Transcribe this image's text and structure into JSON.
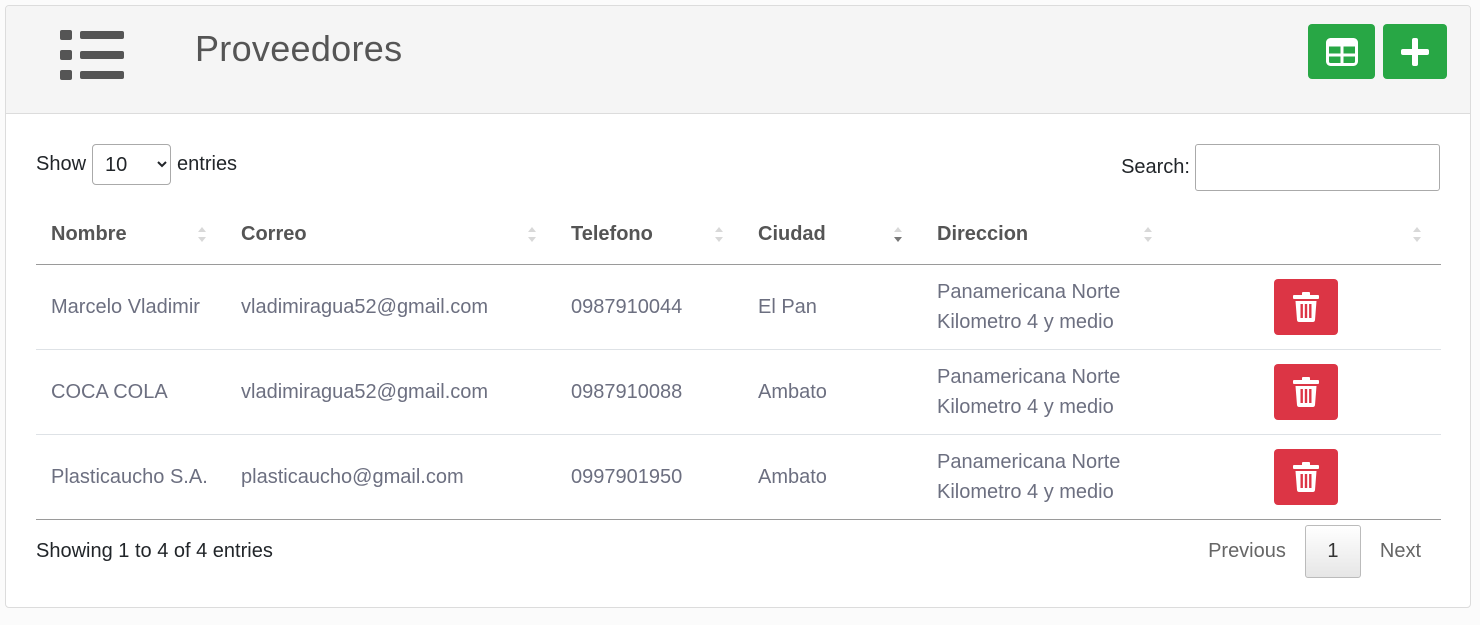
{
  "header": {
    "title": "Proveedores",
    "menu_icon": "list-icon",
    "buttons": [
      {
        "icon": "table-icon",
        "color": "#28a745"
      },
      {
        "icon": "plus-icon",
        "color": "#28a745"
      }
    ]
  },
  "length": {
    "prefix": "Show",
    "value": "10",
    "suffix": "entries"
  },
  "search": {
    "label": "Search:",
    "value": "",
    "placeholder": ""
  },
  "table": {
    "columns": [
      "Nombre",
      "Correo",
      "Telefono",
      "Ciudad",
      "Direccion",
      ""
    ],
    "rows": [
      {
        "nombre": "Marcelo Vladimir",
        "correo": "vladimiragua52@gmail.com",
        "telefono": "0987910044",
        "ciudad": "El Pan",
        "direccion": "Panamericana Norte Kilometro 4 y medio"
      },
      {
        "nombre": "COCA COLA",
        "correo": "vladimiragua52@gmail.com",
        "telefono": "0987910088",
        "ciudad": "Ambato",
        "direccion": "Panamericana Norte Kilometro 4 y medio"
      },
      {
        "nombre": "Plasticaucho S.A.",
        "correo": "plasticaucho@gmail.com",
        "telefono": "0997901950",
        "ciudad": "Ambato",
        "direccion": "Panamericana Norte Kilometro 4 y medio"
      }
    ],
    "delete_icon": "trash-icon",
    "delete_color": "#dc3545"
  },
  "footer": {
    "info": "Showing 1 to 4 of 4 entries",
    "previous": "Previous",
    "current_page": "1",
    "next": "Next"
  }
}
